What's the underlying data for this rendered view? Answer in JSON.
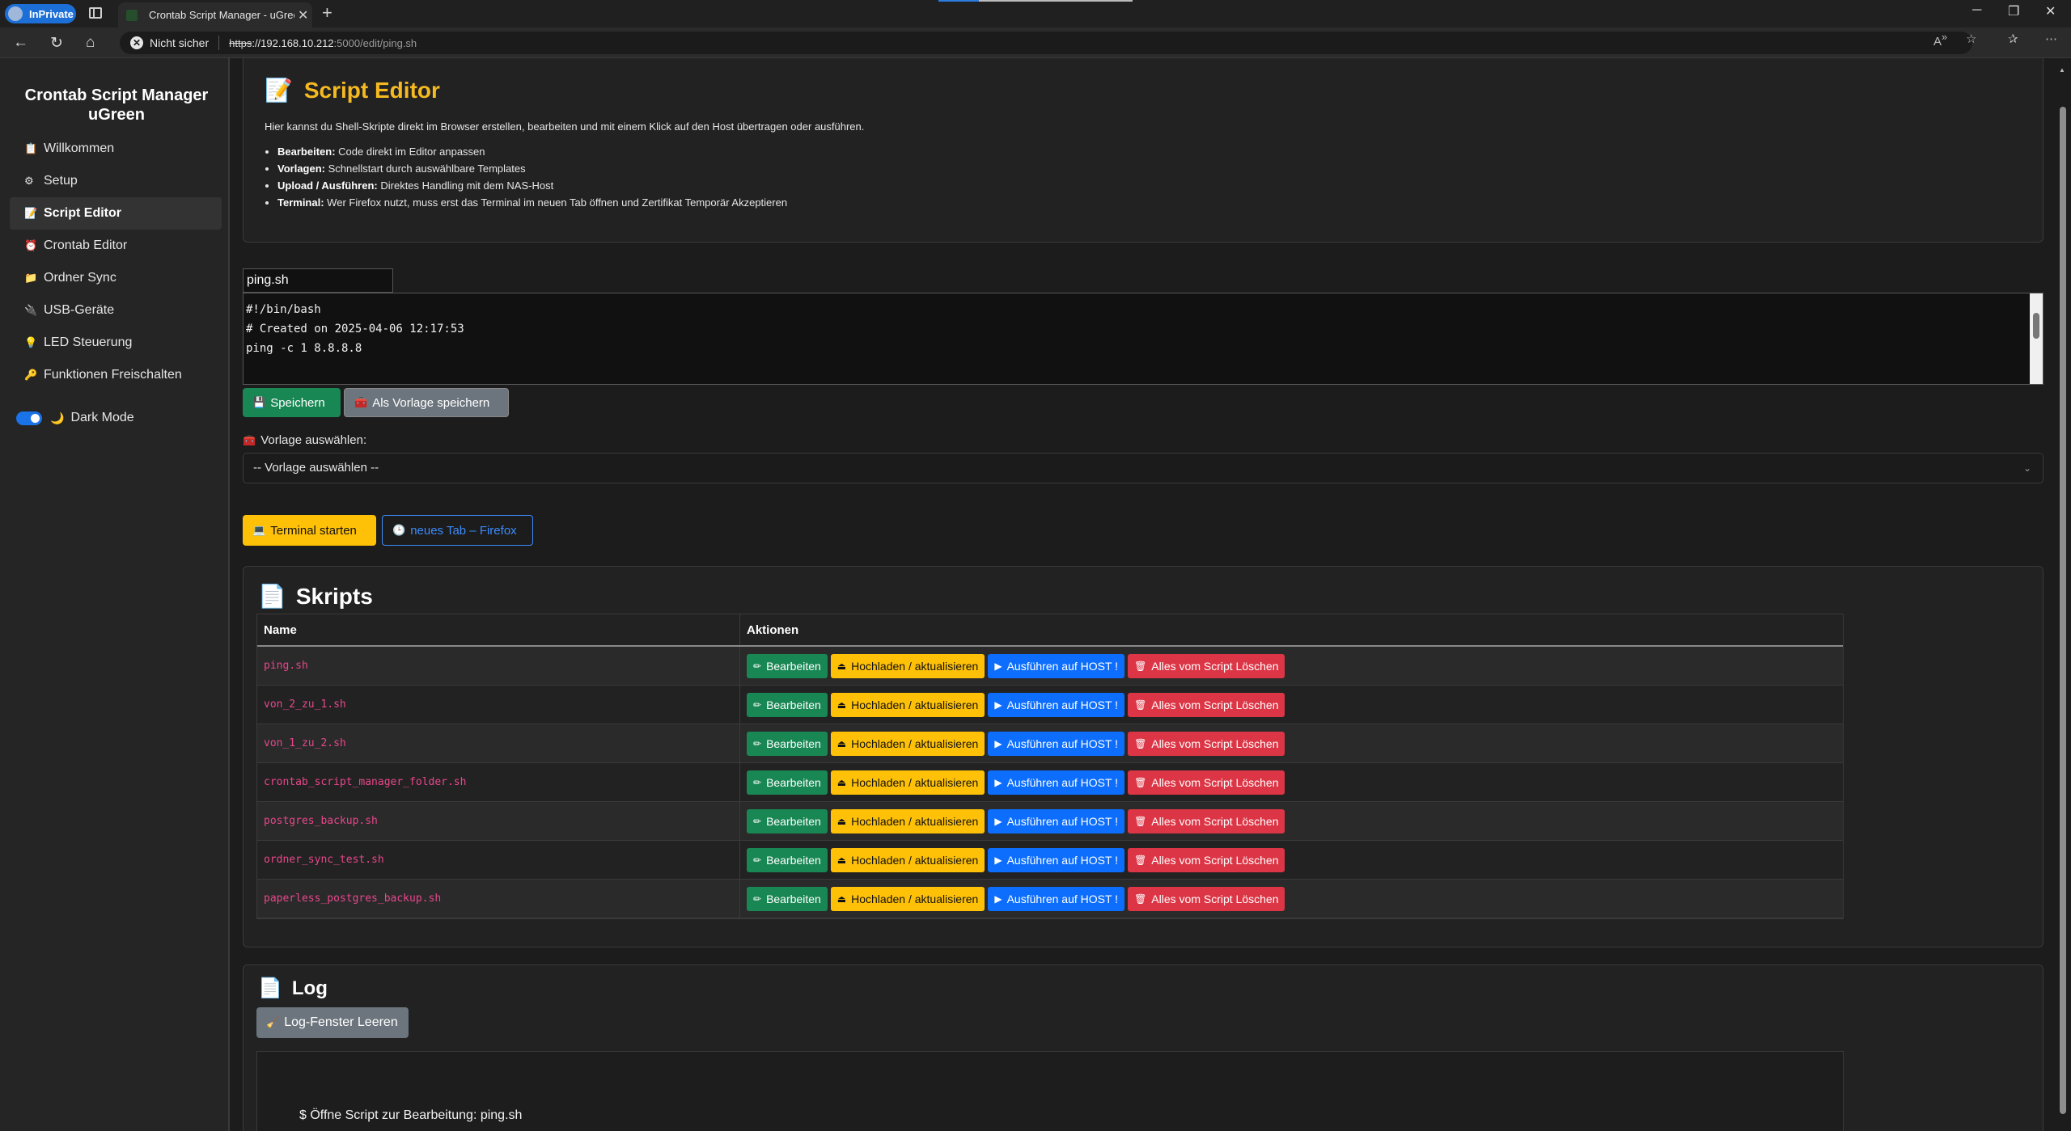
{
  "browser": {
    "inprivate_label": "InPrivate",
    "tab_title": "Crontab Script Manager - uGreen",
    "new_tab": "+",
    "not_secure": "Nicht sicher",
    "url_proto": "https",
    "url_host": "://192.168.10.212",
    "url_path": ":5000/edit/ping.sh"
  },
  "sidebar": {
    "brand": "Crontab Script Manager uGreen",
    "items": [
      {
        "label": "Willkommen",
        "icon": "memo-icon",
        "glyph": "📋"
      },
      {
        "label": "Setup",
        "icon": "gear-icon",
        "glyph": "⚙"
      },
      {
        "label": "Script Editor",
        "icon": "memo-icon",
        "glyph": "📝",
        "active": true
      },
      {
        "label": "Crontab Editor",
        "icon": "alarm-clock-icon",
        "glyph": "⏰"
      },
      {
        "label": "Ordner Sync",
        "icon": "folder-icon",
        "glyph": "📁"
      },
      {
        "label": "USB-Geräte",
        "icon": "plug-icon",
        "glyph": "🔌"
      },
      {
        "label": "LED Steuerung",
        "icon": "bulb-icon",
        "glyph": "💡"
      },
      {
        "label": "Funktionen Freischalten",
        "icon": "key-icon",
        "glyph": "🔑"
      }
    ],
    "dark_mode_label": "Dark Mode",
    "dark_mode_on": true
  },
  "hero": {
    "title": "Script Editor",
    "description": "Hier kannst du Shell-Skripte direkt im Browser erstellen, bearbeiten und mit einem Klick auf den Host übertragen oder ausführen.",
    "bullets": [
      {
        "term": "Bearbeiten:",
        "text": " Code direkt im Editor anpassen"
      },
      {
        "term": "Vorlagen:",
        "text": " Schnellstart durch auswählbare Templates"
      },
      {
        "term": "Upload / Ausführen:",
        "text": " Direktes Handling mit dem NAS-Host"
      },
      {
        "term": "Terminal:",
        "text": " Wer Firefox nutzt, muss erst das Terminal im neuen Tab öffnen und Zertifikat Temporär Akzeptieren"
      }
    ]
  },
  "editor": {
    "filename": "ping.sh",
    "code": "#!/bin/bash\n# Created on 2025-04-06 12:17:53\nping -c 1 8.8.8.8",
    "save_label": "Speichern",
    "save_template_label": "Als Vorlage speichern",
    "template_label": "Vorlage auswählen:",
    "template_selected": "-- Vorlage auswählen --",
    "terminal_label": "Terminal starten",
    "firefox_label": "neues Tab – Firefox"
  },
  "scripts": {
    "title": "Skripts",
    "col_name": "Name",
    "col_actions": "Aktionen",
    "rows": [
      "ping.sh",
      "von_2_zu_1.sh",
      "von_1_zu_2.sh",
      "crontab_script_manager_folder.sh",
      "postgres_backup.sh",
      "ordner_sync_test.sh",
      "paperless_postgres_backup.sh"
    ],
    "actions": {
      "edit": "Bearbeiten",
      "upload": "Hochladen / aktualisieren",
      "run": "Ausführen auf HOST !",
      "delete": "Alles vom Script Löschen"
    }
  },
  "log": {
    "title": "Log",
    "clear_label": "Log-Fenster Leeren",
    "lines": [
      "$ Öffne Script zur Bearbeitung: ping.sh"
    ]
  }
}
